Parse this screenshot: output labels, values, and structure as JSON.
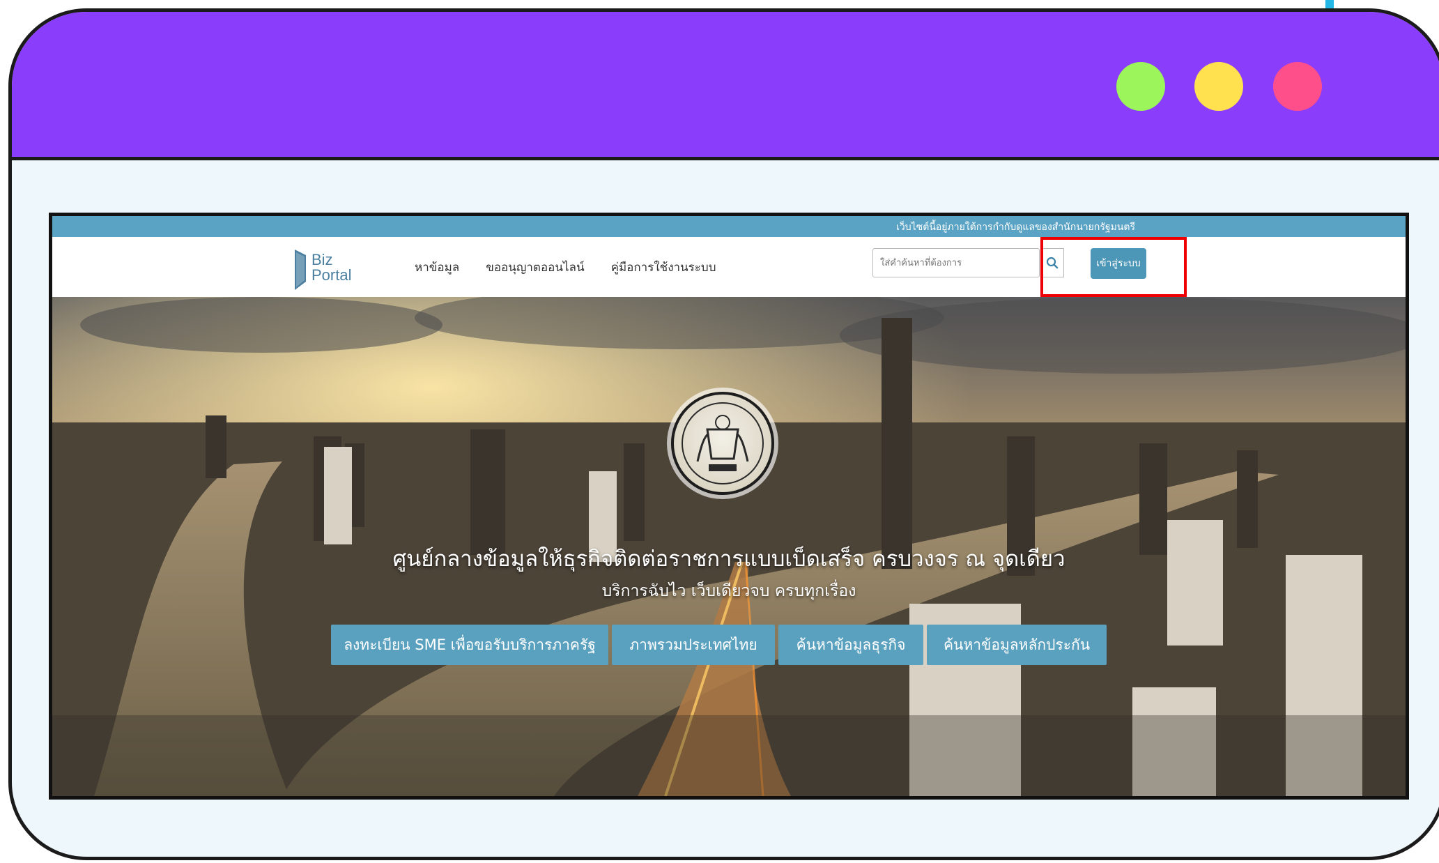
{
  "window": {
    "colors": {
      "titlebar": "#8b3dfc",
      "frame_bg": "#eef7fc",
      "dot_green": "#9cf55a",
      "dot_yellow": "#ffe14f",
      "dot_pink": "#ff4f8b",
      "highlight": "#e00000"
    }
  },
  "site": {
    "notice_bar": "เว็บไซต์นี้อยู่ภายใต้การกำกับดูแลของสำนักนายกรัฐมนตรี",
    "logo": {
      "line1": "Biz",
      "line2": "Portal"
    },
    "menu": [
      {
        "label": "หาข้อมูล"
      },
      {
        "label": "ขออนุญาตออนไลน์"
      },
      {
        "label": "คู่มือการใช้งานระบบ"
      }
    ],
    "search": {
      "placeholder": "ใส่คำค้นหาที่ต้องการ",
      "icon": "search-icon"
    },
    "login_label": "เข้าสู่ระบบ"
  },
  "hero": {
    "title": "ศูนย์กลางข้อมูลให้ธุรกิจติดต่อราชการแบบเบ็ดเสร็จ ครบวงจร ณ จุดเดียว",
    "subtitle": "บริการฉับไว เว็บเดียวจบ ครบทุกเรื่อง",
    "buttons": [
      {
        "label": "ลงทะเบียน SME เพื่อขอรับบริการภาครัฐ"
      },
      {
        "label": "ภาพรวมประเทศไทย"
      },
      {
        "label": "ค้นหาข้อมูลธุรกิจ"
      },
      {
        "label": "ค้นหาข้อมูลหลักประกัน"
      }
    ],
    "colors": {
      "button": "#5aa0bf",
      "accent": "#4c96b8"
    }
  }
}
